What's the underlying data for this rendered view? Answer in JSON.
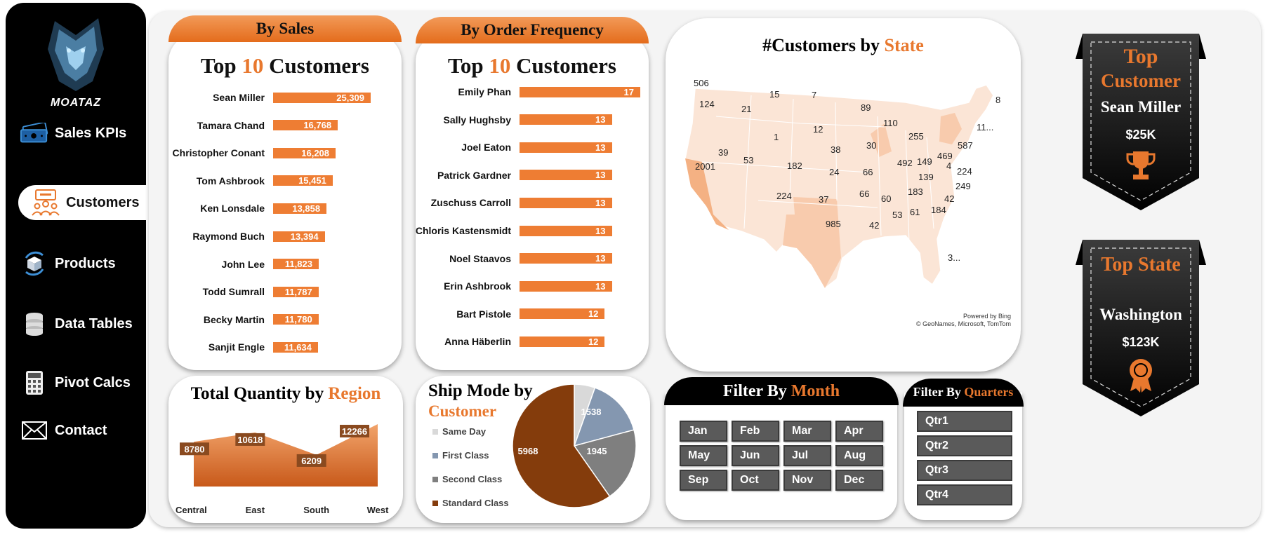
{
  "sidebar": {
    "logo_text": "MOATAZ",
    "items": [
      {
        "label": "Sales KPIs",
        "icon": "money-icon"
      },
      {
        "label": "Customers",
        "icon": "customers-icon"
      },
      {
        "label": "Products",
        "icon": "products-icon"
      },
      {
        "label": "Data Tables",
        "icon": "database-icon"
      },
      {
        "label": "Pivot Calcs",
        "icon": "calculator-icon"
      },
      {
        "label": "Contact",
        "icon": "envelope-icon"
      }
    ]
  },
  "sales_card": {
    "tab": "By Sales",
    "title_a": "Top ",
    "title_num": "10",
    "title_b": " Customers",
    "rows": [
      {
        "name": "Sean Miller",
        "value": 25309,
        "label": "25,309"
      },
      {
        "name": "Tamara Chand",
        "value": 16768,
        "label": "16,768"
      },
      {
        "name": "Christopher Conant",
        "value": 16208,
        "label": "16,208"
      },
      {
        "name": "Tom Ashbrook",
        "value": 15451,
        "label": "15,451"
      },
      {
        "name": "Ken Lonsdale",
        "value": 13858,
        "label": "13,858"
      },
      {
        "name": "Raymond Buch",
        "value": 13394,
        "label": "13,394"
      },
      {
        "name": "John Lee",
        "value": 11823,
        "label": "11,823"
      },
      {
        "name": "Todd Sumrall",
        "value": 11787,
        "label": "11,787"
      },
      {
        "name": "Becky Martin",
        "value": 11780,
        "label": "11,780"
      },
      {
        "name": "Sanjit Engle",
        "value": 11634,
        "label": "11,634"
      }
    ]
  },
  "freq_card": {
    "tab": "By Order Frequency",
    "title_a": "Top ",
    "title_num": "10",
    "title_b": " Customers",
    "rows": [
      {
        "name": "Emily Phan",
        "value": 17,
        "label": "17"
      },
      {
        "name": "Sally Hughsby",
        "value": 13,
        "label": "13"
      },
      {
        "name": "Joel Eaton",
        "value": 13,
        "label": "13"
      },
      {
        "name": "Patrick Gardner",
        "value": 13,
        "label": "13"
      },
      {
        "name": "Zuschuss Carroll",
        "value": 13,
        "label": "13"
      },
      {
        "name": "Chloris Kastensmidt",
        "value": 13,
        "label": "13"
      },
      {
        "name": "Noel Staavos",
        "value": 13,
        "label": "13"
      },
      {
        "name": "Erin Ashbrook",
        "value": 13,
        "label": "13"
      },
      {
        "name": "Bart Pistole",
        "value": 12,
        "label": "12"
      },
      {
        "name": "Anna Häberlin",
        "value": 12,
        "label": "12"
      }
    ]
  },
  "map_card": {
    "title_a": "#Customers by ",
    "title_b": "State",
    "credit_1": "Powered by Bing",
    "credit_2": "© GeoNames, Microsoft, TomTom",
    "labels": [
      "506",
      "124",
      "21",
      "15",
      "7",
      "89",
      "110",
      "8",
      "1",
      "12",
      "255",
      "11...",
      "39",
      "53",
      "2001",
      "182",
      "38",
      "30",
      "492",
      "149",
      "469",
      "587",
      "24",
      "66",
      "139",
      "4",
      "224",
      "183",
      "249",
      "224",
      "37",
      "66",
      "60",
      "42",
      "985",
      "53",
      "61",
      "184",
      "42",
      "3..."
    ]
  },
  "top_customer": {
    "title_1": "Top",
    "title_2": "Customer",
    "name": "Sean Miller",
    "value": "$25K"
  },
  "top_state": {
    "title": "Top State",
    "name": "Washington",
    "value": "$123K"
  },
  "region_card": {
    "title_a": "Total Quantity by ",
    "title_b": "Region",
    "chart_data": {
      "type": "area",
      "categories": [
        "Central",
        "East",
        "South",
        "West"
      ],
      "values": [
        8780,
        10618,
        6209,
        12266
      ]
    }
  },
  "ship_card": {
    "title_a": "Ship Mode by",
    "title_b": "Customer",
    "chart_data": {
      "type": "pie",
      "categories": [
        "Same Day",
        "First Class",
        "Second Class",
        "Standard Class"
      ],
      "values": [
        543,
        1538,
        1945,
        5968
      ],
      "colors": [
        "#d9d9d9",
        "#8497b0",
        "#7f7f7f",
        "#843c0c"
      ]
    }
  },
  "month_filter": {
    "title_a": "Filter By ",
    "title_b": "Month",
    "months": [
      "Jan",
      "Feb",
      "Mar",
      "Apr",
      "May",
      "Jun",
      "Jul",
      "Aug",
      "Sep",
      "Oct",
      "Nov",
      "Dec"
    ]
  },
  "quarter_filter": {
    "title_a": "Filter By ",
    "title_b": "Quarters",
    "quarters": [
      "Qtr1",
      "Qtr2",
      "Qtr3",
      "Qtr4"
    ]
  }
}
